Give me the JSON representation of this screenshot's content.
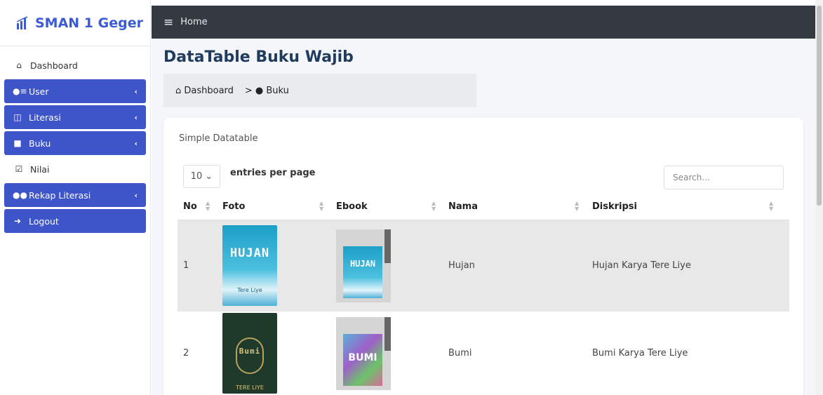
{
  "brand": {
    "name": "SMAN 1 Geger"
  },
  "sidebar": {
    "items": [
      {
        "label": "Dashboard",
        "icon": "home-icon",
        "active": false,
        "has_caret": false
      },
      {
        "label": "User",
        "icon": "user-list-icon",
        "active": true,
        "has_caret": true
      },
      {
        "label": "Literasi",
        "icon": "book-open-icon",
        "active": true,
        "has_caret": true
      },
      {
        "label": "Buku",
        "icon": "book-icon",
        "active": true,
        "has_caret": true
      },
      {
        "label": "Nilai",
        "icon": "checkbox-icon",
        "active": false,
        "has_caret": false
      },
      {
        "label": "Rekap Literasi",
        "icon": "users-icon",
        "active": true,
        "has_caret": true
      },
      {
        "label": "Logout",
        "icon": "sign-out-icon",
        "active": true,
        "has_caret": false
      }
    ]
  },
  "topbar": {
    "home_label": "Home"
  },
  "page": {
    "title": "DataTable Buku Wajib",
    "breadcrumb": {
      "home": "Dashboard",
      "separator": ">",
      "current": "Buku"
    }
  },
  "card": {
    "title": "Simple Datatable",
    "entries_value": "10",
    "entries_label": "entries per page",
    "search_placeholder": "Search..."
  },
  "table": {
    "columns": [
      "No",
      "Foto",
      "Ebook",
      "Nama",
      "Diskripsi"
    ],
    "rows": [
      {
        "no": "1",
        "cover_title": "HUJAN",
        "cover_author": "Tere Liye",
        "ebook_title": "HUJAN",
        "nama": "Hujan",
        "diskripsi": "Hujan Karya Tere Liye"
      },
      {
        "no": "2",
        "cover_title": "Bumi",
        "cover_author": "TERE LIYE",
        "ebook_title": "BUMI",
        "nama": "Bumi",
        "diskripsi": "Bumi Karya Tere Liye"
      }
    ]
  },
  "colors": {
    "accent": "#3e55c9",
    "topbar": "#343a40",
    "brand": "#3b5bd1",
    "title": "#1f3c5e"
  }
}
